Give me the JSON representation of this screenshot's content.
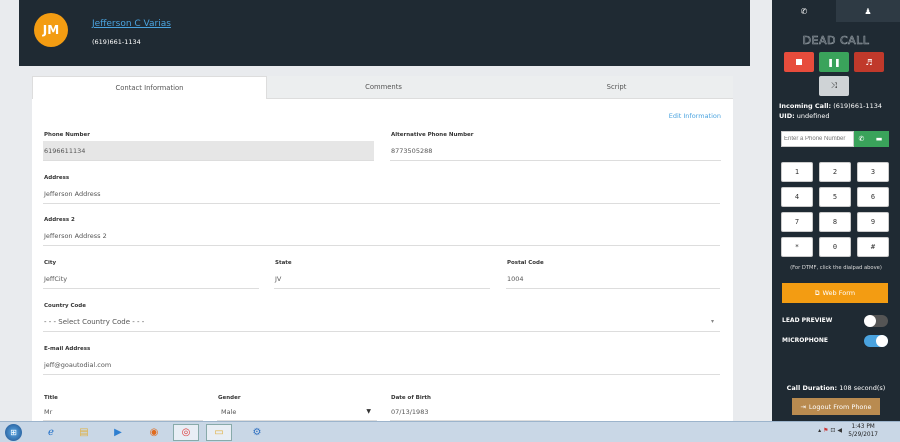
{
  "header": {
    "avatar_initials": "JM",
    "name": "Jefferson C Varias",
    "phone": "(619)661-1134"
  },
  "tabs": [
    {
      "label": "Contact Information"
    },
    {
      "label": "Comments"
    },
    {
      "label": "Script"
    }
  ],
  "edit_link": "Edit Information",
  "form": {
    "phone_number": {
      "label": "Phone Number",
      "value": "6196611134"
    },
    "alt_phone": {
      "label": "Alternative Phone Number",
      "value": "8773505288"
    },
    "address": {
      "label": "Address",
      "value": "Jefferson Address"
    },
    "address2": {
      "label": "Address 2",
      "value": "Jefferson Address 2"
    },
    "city": {
      "label": "City",
      "value": "JeffCity"
    },
    "state": {
      "label": "State",
      "value": "JV"
    },
    "postal": {
      "label": "Postal Code",
      "value": "1004"
    },
    "country": {
      "label": "Country Code",
      "value": "- - - Select Country Code - - -"
    },
    "email": {
      "label": "E-mail Address",
      "value": "jeff@goautodial.com"
    },
    "title": {
      "label": "Title",
      "value": "Mr"
    },
    "gender": {
      "label": "Gender",
      "value": "Male"
    },
    "dob": {
      "label": "Date of Birth",
      "value": "07/13/1983"
    }
  },
  "sidebar": {
    "status_title": "DEAD CALL",
    "incoming_label": "Incoming Call:",
    "incoming_value": "(619)661-1134",
    "uid_label": "UID:",
    "uid_value": "undefined",
    "phone_placeholder": "Enter a Phone Number",
    "keys": [
      "1",
      "2",
      "3",
      "4",
      "5",
      "6",
      "7",
      "8",
      "9",
      "*",
      "0",
      "#"
    ],
    "dtmf_note": "(For DTMF, click the dialpad above)",
    "web_form": "Web Form",
    "lead_preview": "LEAD PREVIEW",
    "microphone": "MICROPHONE",
    "lead_preview_on": false,
    "microphone_on": true,
    "duration_label": "Call Duration:",
    "duration_value": "108 second(s)",
    "logout": "Logout From Phone",
    "colors": {
      "stop": "#e74c3c",
      "pause": "#3aa35b",
      "music": "#c0392b",
      "shuffle": "#cfd3d6",
      "accent": "#f39c12",
      "toggle_on": "#4aa3df"
    }
  },
  "taskbar": {
    "time": "1:43 PM",
    "date": "5/29/2017"
  }
}
